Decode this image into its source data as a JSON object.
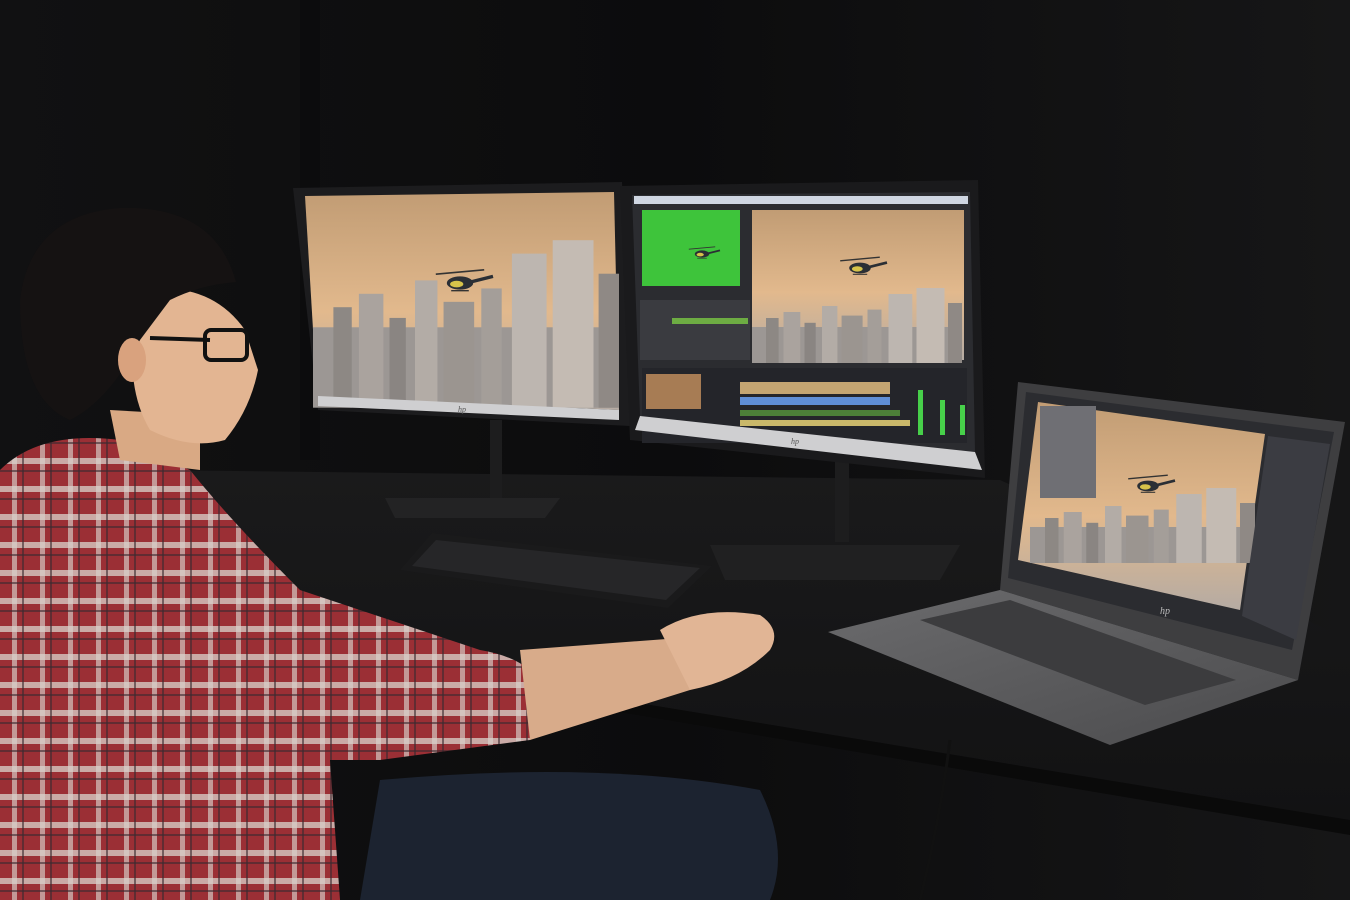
{
  "scene": {
    "description_tag": "photo",
    "palette": {
      "background": "#0b0b0c",
      "desk": "#1c1c1d",
      "sky_top": "#c9a378",
      "sky_bottom": "#e3b98c",
      "haze": "#a9a4a0",
      "green_screen": "#3ec43b",
      "shirt_red": "#9b2f35",
      "shirt_light": "#d9d2cc",
      "laptop_body": "#5a5a5c"
    }
  },
  "monitors": {
    "left": {
      "brand_logo": "hp"
    },
    "center": {
      "brand_logo": "hp",
      "app": "video-editor"
    },
    "laptop": {
      "brand_logo": "hp",
      "app": "photo-editor"
    }
  }
}
